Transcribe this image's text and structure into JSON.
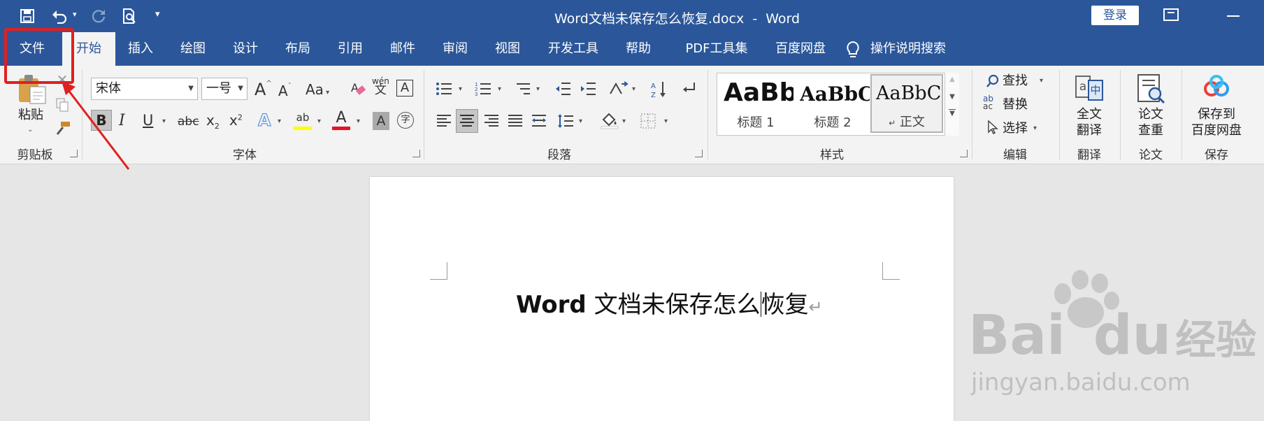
{
  "titlebar": {
    "document_title": "Word文档未保存怎么恢复.docx",
    "separator": "-",
    "app_name": "Word",
    "login_button": "登录",
    "qat_customize_caret": "▾"
  },
  "tabs": [
    {
      "label": "文件"
    },
    {
      "label": "开始"
    },
    {
      "label": "插入"
    },
    {
      "label": "绘图"
    },
    {
      "label": "设计"
    },
    {
      "label": "布局"
    },
    {
      "label": "引用"
    },
    {
      "label": "邮件"
    },
    {
      "label": "审阅"
    },
    {
      "label": "视图"
    },
    {
      "label": "开发工具"
    },
    {
      "label": "帮助"
    },
    {
      "label": "PDF工具集"
    },
    {
      "label": "百度网盘"
    }
  ],
  "search": {
    "label": "操作说明搜索"
  },
  "clipboard": {
    "paste_label": "粘贴",
    "group_label": "剪贴板"
  },
  "font": {
    "font_name": "宋体",
    "font_size": "一号",
    "grow": "A",
    "shrink": "A",
    "change_case": "Aa",
    "phonetic_top": "wén",
    "phonetic_bottom": "文",
    "char_border": "A",
    "bold": "B",
    "italic": "I",
    "underline": "U",
    "strike": "abc",
    "subscript": "x",
    "sub_mark": "2",
    "superscript": "x",
    "sup_mark": "2",
    "text_effect": "A",
    "highlight": "ab",
    "font_color": "A",
    "char_shading": "A",
    "enclose": "字",
    "group_label": "字体",
    "underline_color": "#e81123",
    "highlight_color": "#ffff00"
  },
  "paragraph": {
    "group_label": "段落"
  },
  "styles": {
    "items": [
      {
        "sample": "AaBb",
        "name": "标题 1"
      },
      {
        "sample": "AaBbC",
        "name": "标题 2"
      },
      {
        "sample": "AaBbCc",
        "name": "正文",
        "mark": "↵"
      }
    ],
    "group_label": "样式"
  },
  "editing": {
    "find": "查找",
    "replace": "替换",
    "replace_icon_top": "ab",
    "replace_icon_bottom": "ac",
    "select": "选择",
    "group_label": "编辑"
  },
  "translate": {
    "line1": "全文",
    "line2": "翻译",
    "group_label": "翻译",
    "icon_a": "a",
    "icon_zh": "中"
  },
  "paper": {
    "line1": "论文",
    "line2": "查重",
    "group_label": "论文"
  },
  "save": {
    "line1": "保存到",
    "line2": "百度网盘",
    "group_label": "保存"
  },
  "document": {
    "title_bold": "Word",
    "title_rest": " 文档未保存怎么",
    "title_after_cursor": "恢复",
    "paragraph_mark": "↵"
  },
  "watermark": {
    "brand": "Bai",
    "brand2": "du",
    "cn": "经验",
    "url": "jingyan.baidu.com"
  },
  "colors": {
    "accent": "#2b579a",
    "highlight_box": "#e02020"
  }
}
